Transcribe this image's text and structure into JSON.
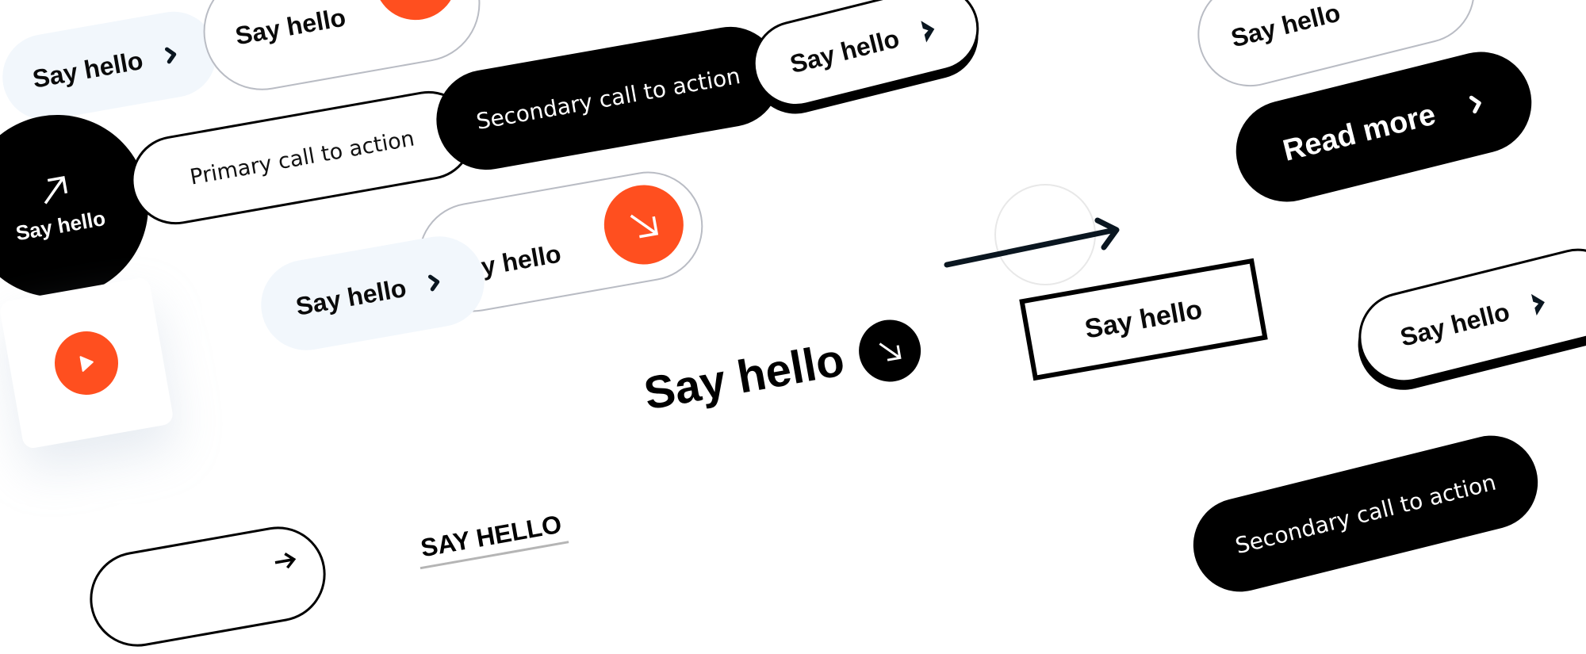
{
  "colors": {
    "accent_orange": "#ff4f1f",
    "soft_bg": "#f2f7fc",
    "black": "#000000",
    "outline_grey": "#b9bcc4",
    "white": "#ffffff"
  },
  "buttons": {
    "soft_say_hello_1": {
      "label": "Say hello",
      "icon": "chevron-right-icon"
    },
    "outline_grey_say_hello_top": {
      "label": "Say hello",
      "icon": "arrow-down-right-icon"
    },
    "circle_say_hello": {
      "label": "Say hello",
      "icon": "arrow-up-right-icon"
    },
    "primary_cta": {
      "label": "Primary call to action"
    },
    "secondary_cta_top": {
      "label": "Secondary call to action"
    },
    "shadow_say_hello_top": {
      "label": "Say hello",
      "icon": "chevron-right-icon"
    },
    "outline_grey_say_hello_top_right": {
      "label": "Say hello",
      "icon": "arrow-down-right-icon"
    },
    "read_more": {
      "label": "Read more",
      "icon": "chevron-right-icon"
    },
    "arrow_circle": {
      "icon": "arrow-right-icon"
    },
    "outline_grey_say_hello_mid": {
      "label": "Say hello",
      "icon": "arrow-down-right-icon"
    },
    "soft_say_hello_2": {
      "label": "Say hello",
      "icon": "chevron-right-icon"
    },
    "play_card": {
      "icon": "play-icon"
    },
    "bottom_outline_partial": {
      "icon": "arrow-right-icon"
    },
    "underlined_say_hello": {
      "label": "SAY HELLO"
    },
    "big_text_say_hello": {
      "label": "Say hello",
      "icon": "arrow-down-right-icon"
    },
    "rect_say_hello": {
      "label": "Say hello"
    },
    "shadow_say_hello_right": {
      "label": "Say hello",
      "icon": "chevron-right-icon"
    },
    "secondary_cta_bottom": {
      "label": "Secondary call to action"
    }
  }
}
